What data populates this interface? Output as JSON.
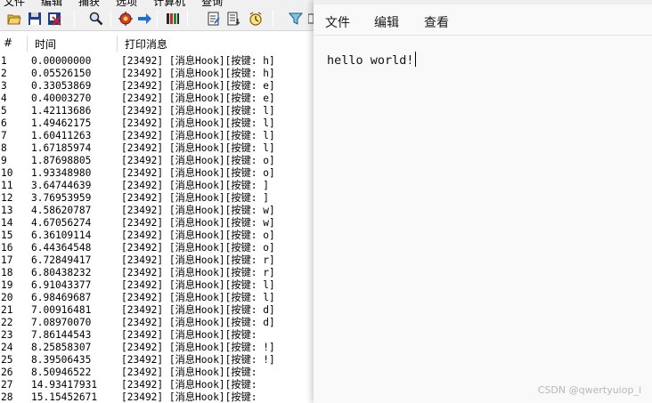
{
  "debugview": {
    "menu": [
      "文件",
      "编辑",
      "捕获",
      "选项",
      "计算机",
      "查询"
    ],
    "columns": {
      "num": "#",
      "time": "时间",
      "message": "打印消息"
    },
    "rows": [
      {
        "n": "1",
        "t": "0.00000000",
        "m": "[23492] [消息Hook][按键: h]"
      },
      {
        "n": "2",
        "t": "0.05526150",
        "m": "[23492] [消息Hook][按键: h]"
      },
      {
        "n": "3",
        "t": "0.33053869",
        "m": "[23492] [消息Hook][按键: e]"
      },
      {
        "n": "4",
        "t": "0.40003270",
        "m": "[23492] [消息Hook][按键: e]"
      },
      {
        "n": "5",
        "t": "1.42113686",
        "m": "[23492] [消息Hook][按键: l]"
      },
      {
        "n": "6",
        "t": "1.49462175",
        "m": "[23492] [消息Hook][按键: l]"
      },
      {
        "n": "7",
        "t": "1.60411263",
        "m": "[23492] [消息Hook][按键: l]"
      },
      {
        "n": "8",
        "t": "1.67185974",
        "m": "[23492] [消息Hook][按键: l]"
      },
      {
        "n": "9",
        "t": "1.87698805",
        "m": "[23492] [消息Hook][按键: o]"
      },
      {
        "n": "10",
        "t": "1.93348980",
        "m": "[23492] [消息Hook][按键: o]"
      },
      {
        "n": "11",
        "t": "3.64744639",
        "m": "[23492] [消息Hook][按键:  ]"
      },
      {
        "n": "12",
        "t": "3.76953959",
        "m": "[23492] [消息Hook][按键:  ]"
      },
      {
        "n": "13",
        "t": "4.58620787",
        "m": "[23492] [消息Hook][按键: w]"
      },
      {
        "n": "14",
        "t": "4.67056274",
        "m": "[23492] [消息Hook][按键: w]"
      },
      {
        "n": "15",
        "t": "6.36109114",
        "m": "[23492] [消息Hook][按键: o]"
      },
      {
        "n": "16",
        "t": "6.44364548",
        "m": "[23492] [消息Hook][按键: o]"
      },
      {
        "n": "17",
        "t": "6.72849417",
        "m": "[23492] [消息Hook][按键: r]"
      },
      {
        "n": "18",
        "t": "6.80438232",
        "m": "[23492] [消息Hook][按键: r]"
      },
      {
        "n": "19",
        "t": "6.91043377",
        "m": "[23492] [消息Hook][按键: l]"
      },
      {
        "n": "20",
        "t": "6.98469687",
        "m": "[23492] [消息Hook][按键: l]"
      },
      {
        "n": "21",
        "t": "7.00916481",
        "m": "[23492] [消息Hook][按键: d]"
      },
      {
        "n": "22",
        "t": "7.08970070",
        "m": "[23492] [消息Hook][按键: d]"
      },
      {
        "n": "23",
        "t": "7.86144543",
        "m": "[23492] [消息Hook][按键:"
      },
      {
        "n": "24",
        "t": "8.25858307",
        "m": "[23492] [消息Hook][按键: !]"
      },
      {
        "n": "25",
        "t": "8.39506435",
        "m": "[23492] [消息Hook][按键: !]"
      },
      {
        "n": "26",
        "t": "8.50946522",
        "m": "[23492] [消息Hook][按键:"
      },
      {
        "n": "27",
        "t": "14.93417931",
        "m": "[23492] [消息Hook][按键:"
      },
      {
        "n": "28",
        "t": "15.15452671",
        "m": "[23492] [消息Hook][按键:"
      }
    ]
  },
  "notepad": {
    "menu": {
      "file": "文件",
      "edit": "编辑",
      "view": "查看"
    },
    "content": "hello world!"
  },
  "watermark": "CSDN @qwertyuiop_i"
}
